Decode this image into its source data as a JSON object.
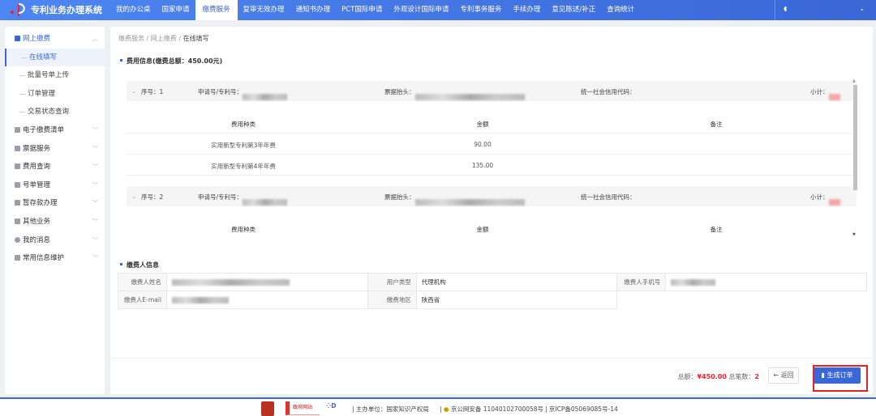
{
  "header": {
    "app_title": "专利业务办理系统",
    "nav": [
      "我的办公桌",
      "国家申请",
      "缴费服务",
      "复审无效办理",
      "通知书办理",
      "PCT国际申请",
      "外观设计国际申请",
      "专利事务服务",
      "手续办理",
      "意见陈述/补正",
      "查询统计"
    ],
    "active_nav": "缴费服务"
  },
  "sidebar": {
    "items": [
      {
        "label": "网上缴费",
        "open": true,
        "children": [
          "在线填写",
          "批量号单上传",
          "订单管理",
          "交易状态查询"
        ],
        "active_child": "在线填写"
      },
      {
        "label": "电子缴费清单"
      },
      {
        "label": "票据服务"
      },
      {
        "label": "费用查询"
      },
      {
        "label": "号单管理"
      },
      {
        "label": "暂存款办理"
      },
      {
        "label": "其他业务"
      },
      {
        "label": "我的消息"
      },
      {
        "label": "常用信息维护"
      }
    ]
  },
  "breadcrumb": [
    "缴费服务",
    "网上缴费",
    "在线填写"
  ],
  "fee_section": {
    "title": "费用信息(缴费总额：450.00元)",
    "groups": [
      {
        "seq_label": "序号：1",
        "app_no_label": "申请号/专利号：",
        "invoice_label": "票据抬头：",
        "credit_code_label": "统一社会信用代码：",
        "subtotal_label": "小计：",
        "columns": [
          "费用种类",
          "金额",
          "备注"
        ],
        "rows": [
          {
            "type": "实用新型专利第3年年费",
            "amount": "90.00",
            "note": ""
          },
          {
            "type": "实用新型专利第4年年费",
            "amount": "135.00",
            "note": ""
          }
        ]
      },
      {
        "seq_label": "序号：2",
        "app_no_label": "申请号/专利号：",
        "invoice_label": "票据抬头：",
        "credit_code_label": "统一社会信用代码：",
        "subtotal_label": "小计：",
        "columns": [
          "费用种类",
          "金额",
          "备注"
        ],
        "rows": []
      }
    ]
  },
  "payer_section": {
    "title": "缴费人信息",
    "name_label": "缴费人姓名",
    "user_type_label": "用户类型",
    "user_type": "代理机构",
    "phone_label": "缴费人手机号",
    "email_label": "缴费人E-mail",
    "region_label": "缴费地区",
    "region": "陕西省"
  },
  "footer_bar": {
    "total_label": "总额：",
    "total": "¥450.00",
    "count_label": "总笔数：",
    "count": "2",
    "back": "← 返回",
    "generate": "生成订单"
  },
  "page_footer": {
    "org": "主办单位：国家知识产权局",
    "police": "京公网安备 11040102700058号",
    "icp": "京ICP备05069085号-14",
    "gov_site": "政府网站"
  },
  "colors": {
    "primary": "#3a66d6",
    "highlight": "#e8231f"
  }
}
